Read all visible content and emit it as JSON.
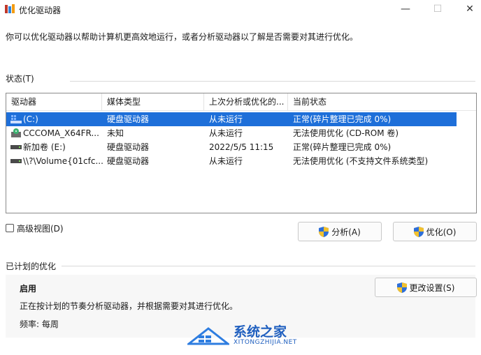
{
  "window": {
    "title": "优化驱动器",
    "minimize": "—",
    "maximize": "☐",
    "close": "✕"
  },
  "intro": "你可以优化驱动器以帮助计算机更高效地运行，或者分析驱动器以了解是否需要对其进行优化。",
  "status_group": {
    "label": "状态(T)"
  },
  "columns": [
    "驱动器",
    "媒体类型",
    "上次分析或优化的...",
    "当前状态"
  ],
  "drives": [
    {
      "name": "(C:)",
      "icon": "system-drive-icon",
      "media": "硬盘驱动器",
      "last": "从未运行",
      "status": "正常(碎片整理已完成 0%)",
      "selected": true
    },
    {
      "name": "CCCOMA_X64FR...",
      "icon": "cdrom-drive-icon",
      "media": "未知",
      "last": "从未运行",
      "status": "无法使用优化 (CD-ROM 卷)",
      "selected": false
    },
    {
      "name": "新加卷 (E:)",
      "icon": "hard-drive-icon",
      "media": "硬盘驱动器",
      "last": "2022/5/5 11:15",
      "status": "正常(碎片整理已完成 0%)",
      "selected": false
    },
    {
      "name": "\\\\?\\Volume{01cfc...",
      "icon": "hard-drive-icon",
      "media": "硬盘驱动器",
      "last": "从未运行",
      "status": "无法使用优化 (不支持文件系统类型)",
      "selected": false
    }
  ],
  "advanced_view": {
    "label": "高级视图(D)",
    "checked": false
  },
  "buttons": {
    "analyze": "分析(A)",
    "optimize": "优化(O)",
    "change_settings": "更改设置(S)"
  },
  "scheduled": {
    "label": "已计划的优化",
    "enabled": "启用",
    "description": "正在按计划的节奏分析驱动器，并根据需要对其进行优化。",
    "frequency": "频率: 每周"
  },
  "watermark": {
    "name": "系统之家",
    "url": "XITONGZHIJIA.NET"
  },
  "colors": {
    "selection": "#1e6fd9",
    "accent": "#1e6fd9"
  }
}
